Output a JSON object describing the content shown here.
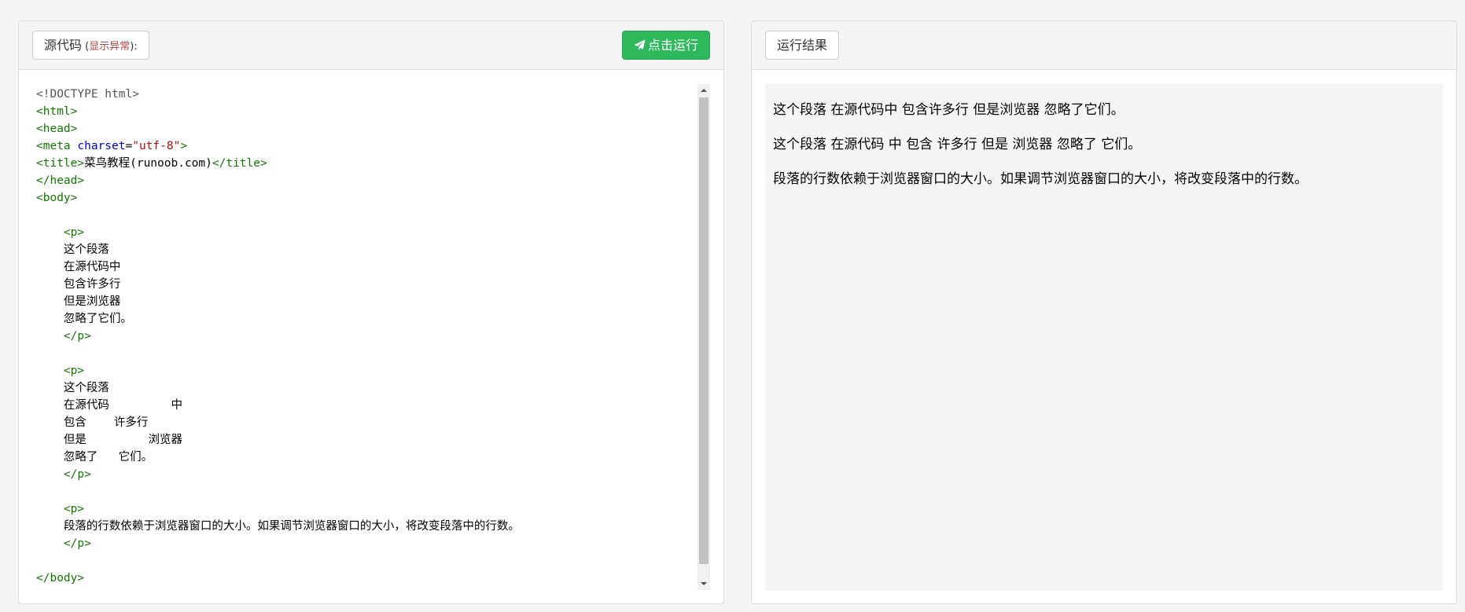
{
  "source_panel": {
    "label": "源代码",
    "label_paren_open": " (",
    "label_warning": "显示异常",
    "label_paren_close": "):",
    "run_button": "点击运行"
  },
  "code_lines": [
    [
      {
        "t": "doctype",
        "s": "<!DOCTYPE html>"
      }
    ],
    [
      {
        "t": "tag",
        "s": "<html>"
      }
    ],
    [
      {
        "t": "tag",
        "s": "<head>"
      }
    ],
    [
      {
        "t": "tag",
        "s": "<meta "
      },
      {
        "t": "attr",
        "s": "charset"
      },
      {
        "t": "text",
        "s": "="
      },
      {
        "t": "str",
        "s": "\"utf-8\""
      },
      {
        "t": "tag",
        "s": ">"
      }
    ],
    [
      {
        "t": "tag",
        "s": "<title>"
      },
      {
        "t": "text",
        "s": "菜鸟教程(runoob.com)"
      },
      {
        "t": "tag",
        "s": "</title>"
      }
    ],
    [
      {
        "t": "tag",
        "s": "</head>"
      }
    ],
    [
      {
        "t": "tag",
        "s": "<body>"
      }
    ],
    [],
    [
      {
        "t": "tag",
        "s": "    <p>"
      }
    ],
    [
      {
        "t": "text",
        "s": "    这个段落"
      }
    ],
    [
      {
        "t": "text",
        "s": "    在源代码中"
      }
    ],
    [
      {
        "t": "text",
        "s": "    包含许多行"
      }
    ],
    [
      {
        "t": "text",
        "s": "    但是浏览器"
      }
    ],
    [
      {
        "t": "text",
        "s": "    忽略了它们。"
      }
    ],
    [
      {
        "t": "tag",
        "s": "    </p>"
      }
    ],
    [],
    [
      {
        "t": "tag",
        "s": "    <p>"
      }
    ],
    [
      {
        "t": "text",
        "s": "    这个段落"
      }
    ],
    [
      {
        "t": "text",
        "s": "    在源代码         中"
      }
    ],
    [
      {
        "t": "text",
        "s": "    包含    许多行"
      }
    ],
    [
      {
        "t": "text",
        "s": "    但是         浏览器"
      }
    ],
    [
      {
        "t": "text",
        "s": "    忽略了   它们。"
      }
    ],
    [
      {
        "t": "tag",
        "s": "    </p>"
      }
    ],
    [],
    [
      {
        "t": "tag",
        "s": "    <p>"
      }
    ],
    [
      {
        "t": "text",
        "s": "    段落的行数依赖于浏览器窗口的大小。如果调节浏览器窗口的大小，将改变段落中的行数。"
      }
    ],
    [
      {
        "t": "tag",
        "s": "    </p>"
      }
    ],
    [],
    [
      {
        "t": "tag",
        "s": "</body>"
      }
    ]
  ],
  "result_panel": {
    "label": "运行结果",
    "paragraphs": [
      "这个段落 在源代码中 包含许多行 但是浏览器 忽略了它们。",
      "这个段落 在源代码 中 包含 许多行 但是 浏览器 忽略了 它们。",
      "段落的行数依赖于浏览器窗口的大小。如果调节浏览器窗口的大小，将改变段落中的行数。"
    ]
  }
}
